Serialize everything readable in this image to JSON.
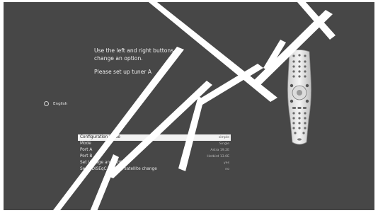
{
  "instructions": {
    "line1": "Use the left and right buttons to",
    "line2": "change an option.",
    "line3": "Please set up tuner A"
  },
  "language": {
    "label": "English"
  },
  "settings": {
    "rows": [
      {
        "label": "Configuration Mode",
        "value": "simple"
      },
      {
        "label": "Mode",
        "value": "Single"
      },
      {
        "label": "Port A",
        "value": "Astra 19.2E"
      },
      {
        "label": "Port B",
        "value": "Hotbird 13.0E"
      },
      {
        "label": "Set Voltage and 22KHz",
        "value": "yes"
      },
      {
        "label": "Send DiSEqC only on satellite change",
        "value": "no"
      }
    ]
  },
  "colors": {
    "background": "#474747",
    "selected_row": "#f2f2f2"
  },
  "icons": {
    "remote": "remote-control-icon",
    "radio": "radio-button-icon"
  }
}
